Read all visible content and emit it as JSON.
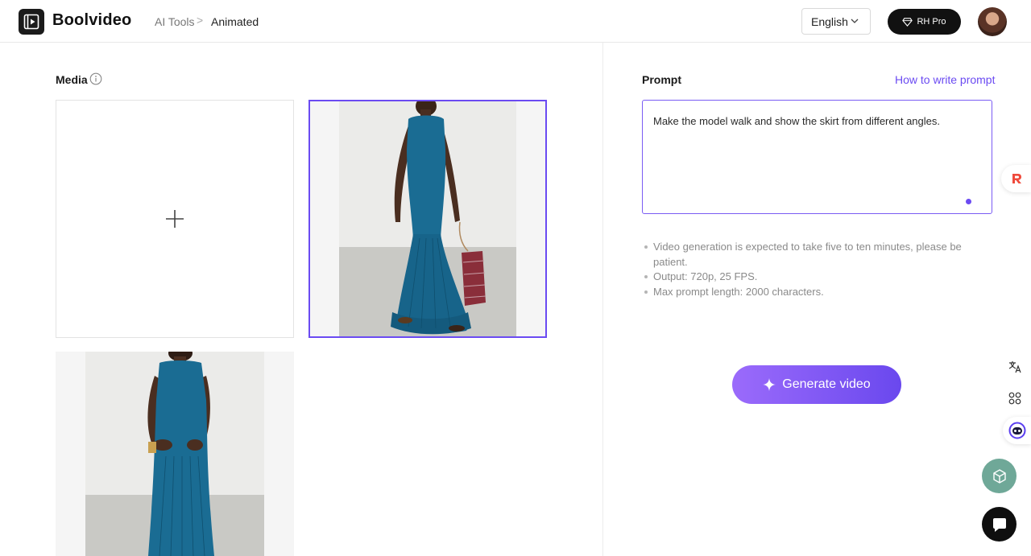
{
  "header": {
    "brand": "Boolvideo",
    "breadcrumb": [
      "AI Tools",
      "Animated"
    ],
    "breadcrumb_separator": ">",
    "language": "English",
    "pro_label": "RH Pro"
  },
  "media": {
    "label": "Media"
  },
  "prompt": {
    "label": "Prompt",
    "help_link": "How to write prompt",
    "value": "Make the model walk and show the skirt from different angles.",
    "notes": [
      "Video generation is expected to take five to ten minutes, please be patient.",
      "Output: 720p, 25 FPS.",
      "Max prompt length: 2000 characters."
    ]
  },
  "actions": {
    "generate_label": "Generate video"
  },
  "colors": {
    "accent": "#6b4bf2",
    "button_gradient_start": "#9b6bfb",
    "button_gradient_end": "#6a48ee",
    "dress": "#1a6c93"
  },
  "icons": {
    "logo": "film-icon",
    "info": "info-icon",
    "add": "plus-icon",
    "pro": "diamond-icon",
    "generate": "sparkle-icon",
    "float": [
      "r-logo-icon",
      "translate-icon",
      "apps-icon",
      "bot-icon",
      "cube-icon",
      "chat-icon"
    ]
  }
}
